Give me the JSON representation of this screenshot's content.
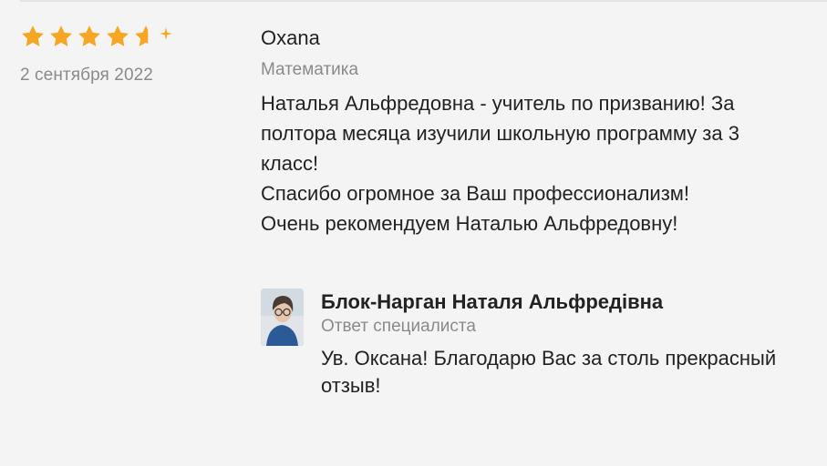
{
  "review": {
    "rating": {
      "value": 4.5,
      "max": 5,
      "star_color": "#f6a623",
      "icons": [
        "star-icon",
        "star-icon",
        "star-icon",
        "star-icon",
        "half-star-icon",
        "sparkle-icon"
      ]
    },
    "date": "2 сентября 2022",
    "author": "Oxana",
    "subject": "Математика",
    "text_lines": [
      "Наталья Альфредовна - учитель по призванию! За",
      "полтора месяца изучили школьную программу за 3",
      "класс!",
      "Спасибо огромное за Ваш профессионализм!",
      "Очень рекомендуем Наталью Альфредовну!"
    ]
  },
  "reply": {
    "name": "Блок-Нарган Наталя Альфредівна",
    "role": "Ответ специалиста",
    "text_lines": [
      "Ув. Оксана! Благодарю Вас за столь прекрасный",
      "отзыв!"
    ]
  },
  "colors": {
    "background": "#f4f4f4",
    "text": "#222222",
    "muted": "#8a8a8a",
    "accent_star": "#f6a623"
  }
}
